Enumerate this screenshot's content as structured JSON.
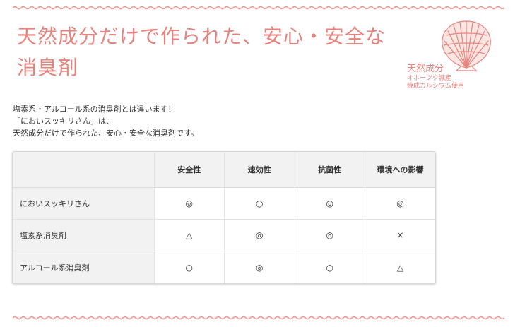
{
  "title": {
    "line1": "天然成分だけで作られた、安心・安全な",
    "line2": "消臭剤"
  },
  "badge": {
    "title": "天然成分",
    "subtitle1": "オホーツク減産",
    "subtitle2": "焼成カルシウム使用",
    "icon": "scallop-shell-icon"
  },
  "intro": {
    "line1": "塩素系・アルコール系の消臭剤とは違います！",
    "line2": "「においスッキリさん」は、",
    "line3": "天然成分だけで作られた、安心・安全な消臭剤です。"
  },
  "table": {
    "headers": [
      "",
      "安全性",
      "速効性",
      "抗菌性",
      "環境への影響"
    ],
    "rows": [
      {
        "label": "においスッキリさん",
        "cells": [
          "◎",
          "○",
          "◎",
          "◎"
        ]
      },
      {
        "label": "塩素系消臭剤",
        "cells": [
          "△",
          "◎",
          "◎",
          "×"
        ]
      },
      {
        "label": "アルコール系消臭剤",
        "cells": [
          "○",
          "◎",
          "○",
          "△"
        ]
      }
    ]
  },
  "colors": {
    "accent": "#e8827c",
    "text": "#333333",
    "table_header_bg": "#f2f2f2"
  }
}
